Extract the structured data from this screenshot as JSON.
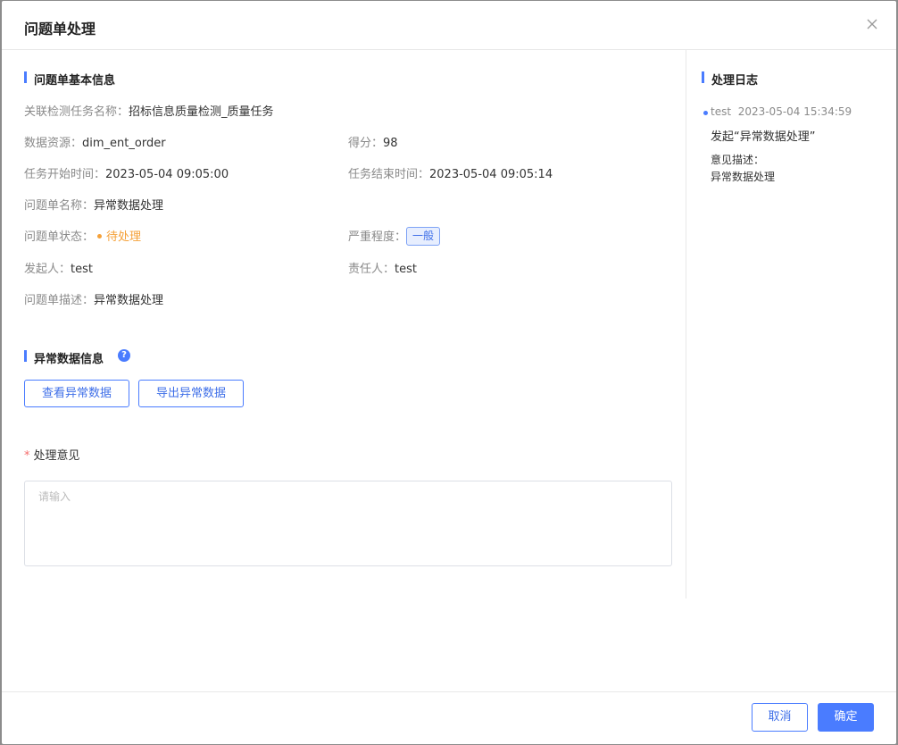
{
  "dialog": {
    "title": "问题单处理",
    "close_icon": "close-icon"
  },
  "basic_info": {
    "section_title": "问题单基本信息",
    "task_name": {
      "label": "关联检测任务名称：",
      "value": "招标信息质量检测_质量任务"
    },
    "data_resource": {
      "label": "数据资源：",
      "value": "dim_ent_order"
    },
    "score": {
      "label": "得分：",
      "value": "98"
    },
    "start_time": {
      "label": "任务开始时间：",
      "value": "2023-05-04 09:05:00"
    },
    "end_time": {
      "label": "任务结束时间：",
      "value": "2023-05-04 09:05:14"
    },
    "issue_name": {
      "label": "问题单名称：",
      "value": "异常数据处理"
    },
    "status": {
      "label": "问题单状态：",
      "value": "待处理",
      "color": "#f5a139"
    },
    "severity": {
      "label": "严重程度：",
      "value": "一般",
      "color": "#3f6fe8"
    },
    "initiator": {
      "label": "发起人：",
      "value": "test"
    },
    "assignee": {
      "label": "责任人：",
      "value": "test"
    },
    "description": {
      "label": "问题单描述：",
      "value": "异常数据处理"
    }
  },
  "abnormal_data": {
    "section_title": "异常数据信息",
    "help_icon": "question-circle-icon",
    "help_glyph": "?",
    "view_button": "查看异常数据",
    "export_button": "导出异常数据"
  },
  "opinion": {
    "required_mark": "*",
    "label": "处理意见",
    "placeholder": "请输入",
    "value": ""
  },
  "log": {
    "section_title": "处理日志",
    "items": [
      {
        "user": "test",
        "time": "2023-05-04 15:34:59",
        "action": "发起“异常数据处理”",
        "opinion_label": "意见描述：",
        "opinion_text": "异常数据处理"
      }
    ]
  },
  "footer": {
    "cancel_label": "取消",
    "confirm_label": "确定"
  },
  "colors": {
    "accent": "#4a7cff",
    "pending": "#f5a139"
  }
}
